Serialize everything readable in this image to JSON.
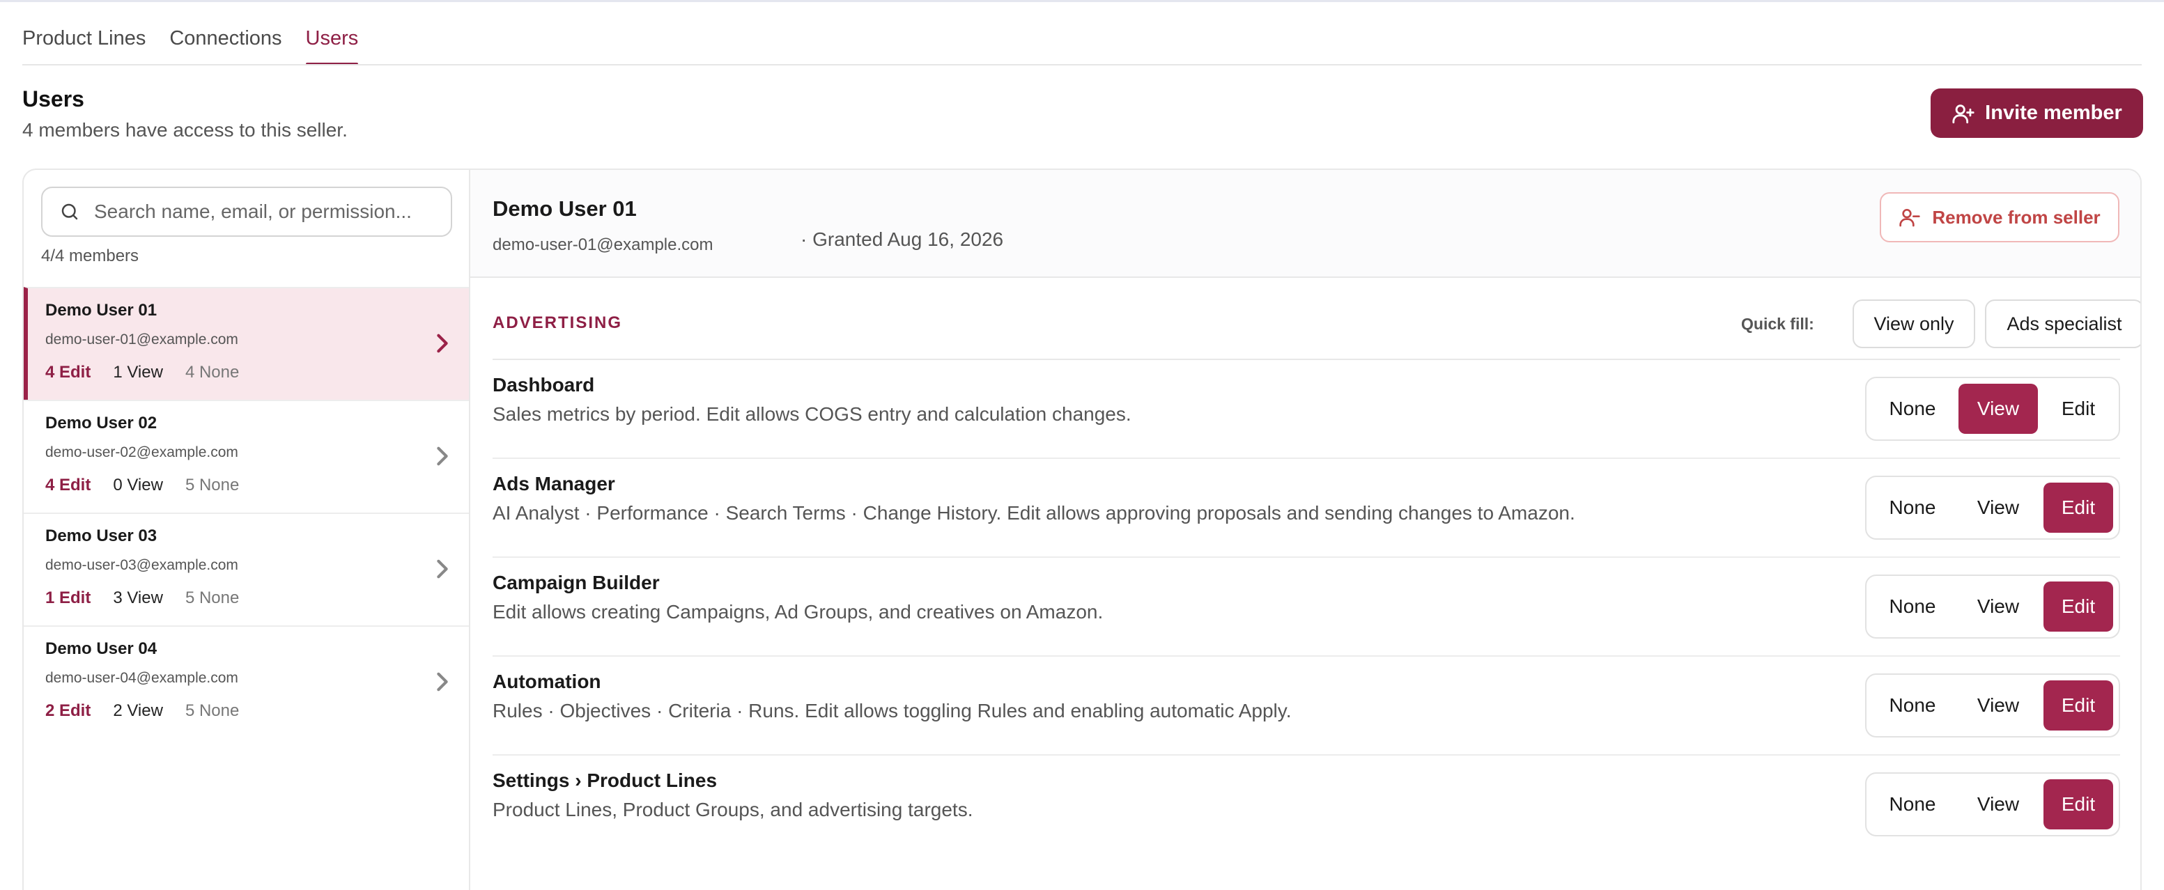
{
  "tabs": [
    {
      "label": "Product Lines",
      "active": false
    },
    {
      "label": "Connections",
      "active": false
    },
    {
      "label": "Users",
      "active": true
    }
  ],
  "header": {
    "title": "Users",
    "subtitle": "4 members have access to this seller.",
    "invite_label": "Invite member"
  },
  "search": {
    "placeholder": "Search name, email, or permission...",
    "count_label": "4/4 members"
  },
  "users": [
    {
      "name": "Demo User 01",
      "email": "demo-user-01@example.com",
      "edit": "4 Edit",
      "view": "1 View",
      "none": "4 None",
      "selected": true
    },
    {
      "name": "Demo User 02",
      "email": "demo-user-02@example.com",
      "edit": "4 Edit",
      "view": "0 View",
      "none": "5 None",
      "selected": false
    },
    {
      "name": "Demo User 03",
      "email": "demo-user-03@example.com",
      "edit": "1 Edit",
      "view": "3 View",
      "none": "5 None",
      "selected": false
    },
    {
      "name": "Demo User 04",
      "email": "demo-user-04@example.com",
      "edit": "2 Edit",
      "view": "2 View",
      "none": "5 None",
      "selected": false
    }
  ],
  "detail": {
    "name": "Demo User 01",
    "email": "demo-user-01@example.com",
    "granted": "· Granted Aug 16, 2026",
    "remove_label": "Remove from seller"
  },
  "section": {
    "label": "ADVERTISING",
    "quick_fill_label": "Quick fill:",
    "quick_fill_view_only": "View only",
    "quick_fill_ads_specialist": "Ads specialist"
  },
  "levels": {
    "none": "None",
    "view": "View",
    "edit": "Edit"
  },
  "permissions": [
    {
      "title": "Dashboard",
      "desc": "Sales metrics by period. Edit allows COGS entry and calculation changes.",
      "level": "view"
    },
    {
      "title": "Ads Manager",
      "desc": "AI Analyst · Performance · Search Terms · Change History. Edit allows approving proposals and sending changes to Amazon.",
      "level": "edit"
    },
    {
      "title": "Campaign Builder",
      "desc": "Edit allows creating Campaigns, Ad Groups, and creatives on Amazon.",
      "level": "edit"
    },
    {
      "title": "Automation",
      "desc": "Rules · Objectives · Criteria · Runs. Edit allows toggling Rules and enabling automatic Apply.",
      "level": "edit"
    },
    {
      "title": "Settings › Product Lines",
      "desc": "Product Lines, Product Groups, and advertising targets.",
      "level": "edit"
    }
  ],
  "colors": {
    "brand": "#8a1f40",
    "brand_active_segment": "#a3264f",
    "selected_row_bg": "#f9e7eb",
    "danger_text": "#c04545"
  },
  "icons": {
    "invite": "user-plus-icon",
    "search": "search-icon",
    "remove": "user-minus-icon",
    "row_chevron": "chevron-right-icon"
  }
}
